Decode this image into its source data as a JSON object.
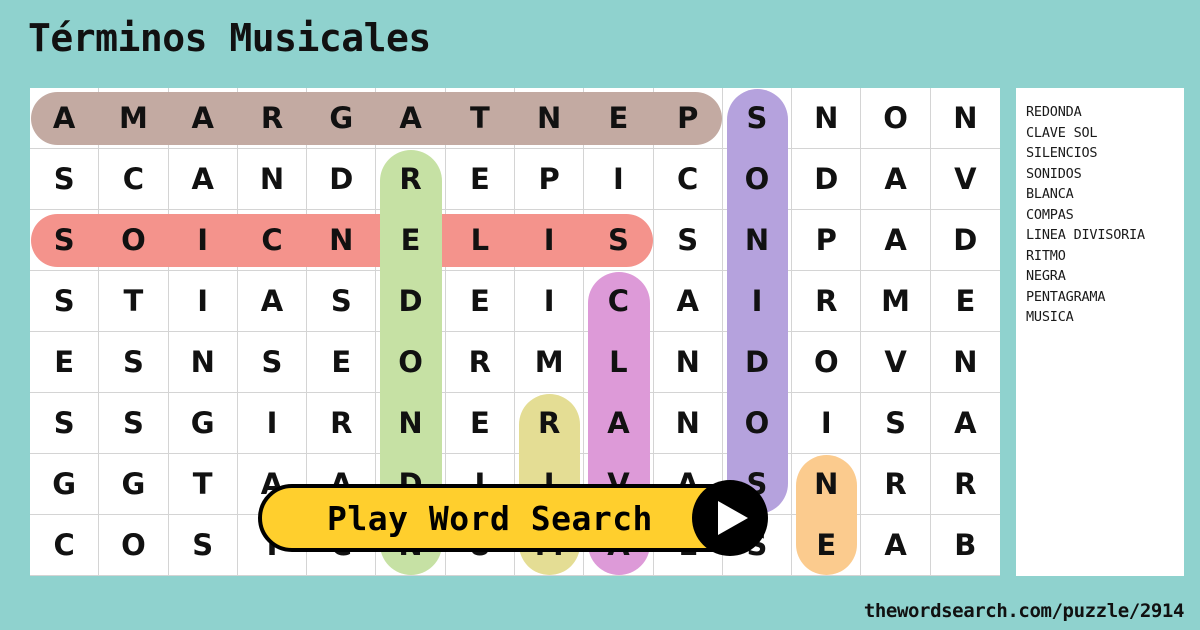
{
  "title": "Términos Musicales",
  "footer": {
    "url": "thewordsearch.com/puzzle/2914"
  },
  "play_button": {
    "label": "Play Word Search",
    "icon": "play-triangle-icon"
  },
  "colors": {
    "background": "#8fd2ce",
    "panel": "#ffffff",
    "grid_line": "#d4d4d4",
    "letter": "#111111",
    "button_fill": "#ffcf2d",
    "button_border": "#000000",
    "hl_brown": "#c3aaa2",
    "hl_salmon": "#f4938c",
    "hl_green": "#c6e1a4",
    "hl_purple": "#b5a2dd",
    "hl_magenta": "#dd9ad8",
    "hl_yellow": "#e4dd94",
    "hl_orange": "#fbcb8e",
    "hl_overlap": "#d68a62"
  },
  "word_list": {
    "words": [
      "REDONDA",
      "CLAVE SOL",
      "SILENCIOS",
      "SONIDOS",
      "BLANCA",
      "COMPAS",
      "LINEA DIVISORIA",
      "RITMO",
      "NEGRA",
      "PENTAGRAMA",
      "MUSICA"
    ]
  },
  "grid": {
    "columns": 14,
    "rows": 8,
    "letters": [
      [
        "A",
        "M",
        "A",
        "R",
        "G",
        "A",
        "T",
        "N",
        "E",
        "P",
        "S",
        "N",
        "O",
        "N"
      ],
      [
        "S",
        "C",
        "A",
        "N",
        "D",
        "R",
        "E",
        "P",
        "I",
        "C",
        "O",
        "D",
        "A",
        "V"
      ],
      [
        "S",
        "O",
        "I",
        "C",
        "N",
        "E",
        "L",
        "I",
        "S",
        "S",
        "N",
        "P",
        "A",
        "D"
      ],
      [
        "S",
        "T",
        "I",
        "A",
        "S",
        "D",
        "E",
        "I",
        "C",
        "A",
        "I",
        "R",
        "M",
        "E"
      ],
      [
        "E",
        "S",
        "N",
        "S",
        "E",
        "O",
        "R",
        "M",
        "L",
        "N",
        "D",
        "O",
        "V",
        "N"
      ],
      [
        "S",
        "S",
        "G",
        "I",
        "R",
        "N",
        "E",
        "R",
        "A",
        "N",
        "O",
        "I",
        "S",
        "A"
      ],
      [
        "G",
        "G",
        "T",
        "A",
        "A",
        "D",
        "I",
        "I",
        "V",
        "A",
        "S",
        "N",
        "R",
        "R"
      ],
      [
        "C",
        "O",
        "S",
        "I",
        "C",
        "N",
        "U",
        "M",
        "A",
        "L",
        "S",
        "E",
        "A",
        "B"
      ]
    ],
    "highlights": [
      {
        "word": "PENTAGRAMA",
        "color": "#c3aaa2",
        "orientation": "horizontal",
        "row": 1,
        "col_start": 1,
        "col_end": 10
      },
      {
        "word": "SILENCIOS",
        "color": "#f4938c",
        "orientation": "horizontal",
        "row": 3,
        "col_start": 1,
        "col_end": 9
      },
      {
        "word": "REDONDA",
        "color": "#c6e1a4",
        "orientation": "vertical",
        "col": 6,
        "row_start": 2,
        "row_end": 8
      },
      {
        "word": "SONIDOS",
        "color": "#b5a2dd",
        "orientation": "vertical",
        "col": 11,
        "row_start": 1,
        "row_end": 7
      },
      {
        "word": "CLAVE SOL",
        "color": "#dd9ad8",
        "orientation": "vertical",
        "col": 9,
        "row_start": 4,
        "row_end": 8
      },
      {
        "word": "RITMO",
        "color": "#e4dd94",
        "orientation": "vertical",
        "col": 8,
        "row_start": 6,
        "row_end": 8
      },
      {
        "word": "NEGRA",
        "color": "#fbcb8e",
        "orientation": "vertical",
        "col": 12,
        "row_start": 7,
        "row_end": 8
      }
    ]
  }
}
